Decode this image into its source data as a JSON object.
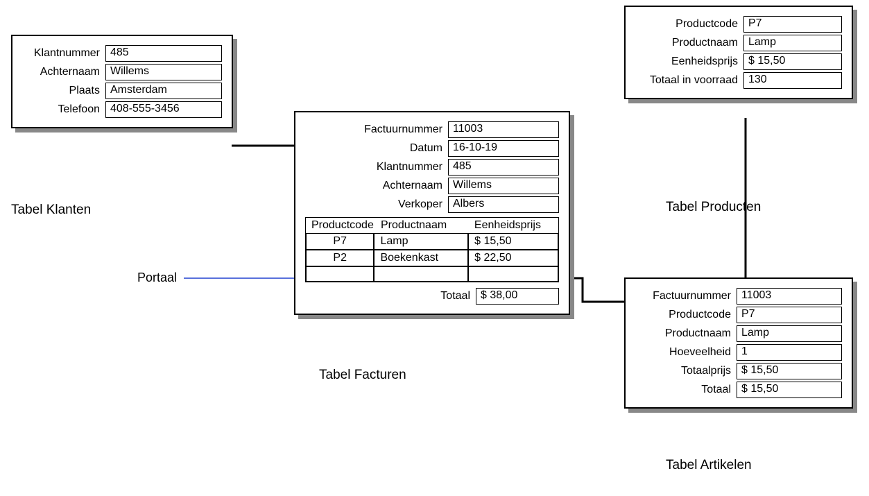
{
  "klanten": {
    "caption": "Tabel Klanten",
    "fields": {
      "klantnummer_label": "Klantnummer",
      "klantnummer": "485",
      "achternaam_label": "Achternaam",
      "achternaam": "Willems",
      "plaats_label": "Plaats",
      "plaats": "Amsterdam",
      "telefoon_label": "Telefoon",
      "telefoon": "408-555-3456"
    }
  },
  "facturen": {
    "caption": "Tabel Facturen",
    "fields": {
      "factuurnummer_label": "Factuurnummer",
      "factuurnummer": "11003",
      "datum_label": "Datum",
      "datum": "16-10-19",
      "klantnummer_label": "Klantnummer",
      "klantnummer": "485",
      "achternaam_label": "Achternaam",
      "achternaam": "Willems",
      "verkoper_label": "Verkoper",
      "verkoper": "Albers",
      "totaal_label": "Totaal",
      "totaal": "$ 38,00"
    },
    "portal": {
      "headers": {
        "code": "Productcode",
        "naam": "Productnaam",
        "prijs": "Eenheidsprijs"
      },
      "rows": [
        {
          "code": "P7",
          "naam": "Lamp",
          "prijs": "$ 15,50"
        },
        {
          "code": "P2",
          "naam": "Boekenkast",
          "prijs": "$ 22,50"
        },
        {
          "code": "",
          "naam": "",
          "prijs": ""
        }
      ]
    }
  },
  "producten": {
    "caption": "Tabel Producten",
    "fields": {
      "productcode_label": "Productcode",
      "productcode": "P7",
      "productnaam_label": "Productnaam",
      "productnaam": "Lamp",
      "eenheidsprijs_label": "Eenheidsprijs",
      "eenheidsprijs": "$ 15,50",
      "voorraad_label": "Totaal in voorraad",
      "voorraad": "130"
    }
  },
  "artikelen": {
    "caption": "Tabel Artikelen",
    "fields": {
      "factuurnummer_label": "Factuurnummer",
      "factuurnummer": "11003",
      "productcode_label": "Productcode",
      "productcode": "P7",
      "productnaam_label": "Productnaam",
      "productnaam": "Lamp",
      "hoeveelheid_label": "Hoeveelheid",
      "hoeveelheid": "1",
      "totaalprijs_label": "Totaalprijs",
      "totaalprijs": "$ 15,50",
      "totaal_label": "Totaal",
      "totaal": "$ 15,50"
    }
  },
  "labels": {
    "portaal": "Portaal"
  }
}
